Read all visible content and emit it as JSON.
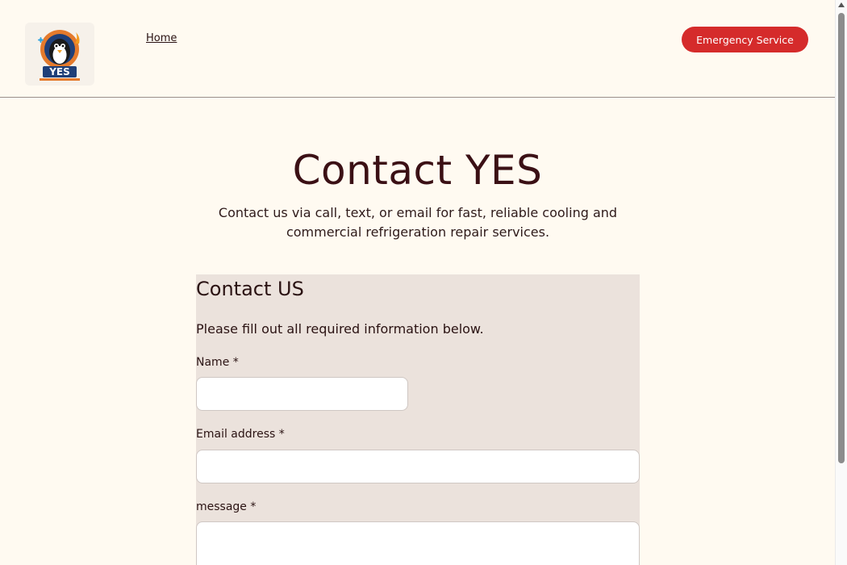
{
  "header": {
    "logo_text": "YES",
    "nav_home": "Home",
    "emergency_button": "Emergency Service"
  },
  "hero": {
    "title": "Contact YES",
    "subtitle": "Contact us via call, text, or email for fast, reliable cooling and commercial refrigeration repair services."
  },
  "form": {
    "title": "Contact US",
    "note": "Please fill out all required information below.",
    "name_label": "Name *",
    "name_value": "",
    "email_label": "Email address *",
    "email_value": "",
    "message_label": "message *",
    "message_value": ""
  },
  "colors": {
    "background": "#fffaf1",
    "accent": "#d52b2b",
    "form_panel": "#ebe2dc",
    "heading": "#3b1015"
  },
  "icons": {
    "logo": "penguin-mascot-logo",
    "scroll_up": "scroll-up-arrow-icon"
  }
}
